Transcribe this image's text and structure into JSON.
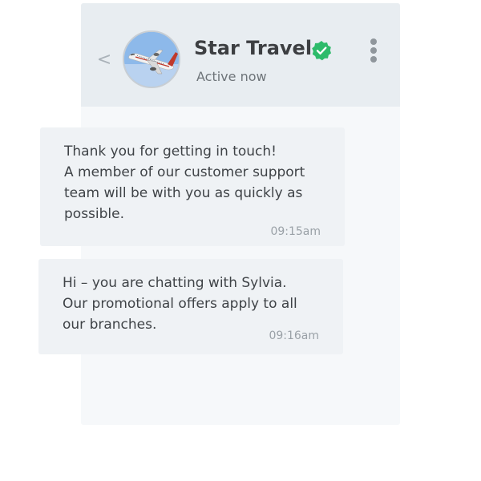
{
  "header": {
    "back_glyph": "<",
    "title": "Star Travel",
    "status": "Active now",
    "verified_color": "#2dbb6a",
    "avatar_icon": "airplane-avatar",
    "menu_icon": "kebab-menu-icon"
  },
  "messages": [
    {
      "lines": [
        "Thank you for getting in touch!",
        "A member of our customer support",
        "team will be with you as quickly as",
        "possible."
      ],
      "time": "09:15am"
    },
    {
      "lines": [
        "Hi – you are chatting with Sylvia.",
        "Our promotional offers apply to all",
        "our branches."
      ],
      "time": "09:16am"
    }
  ]
}
